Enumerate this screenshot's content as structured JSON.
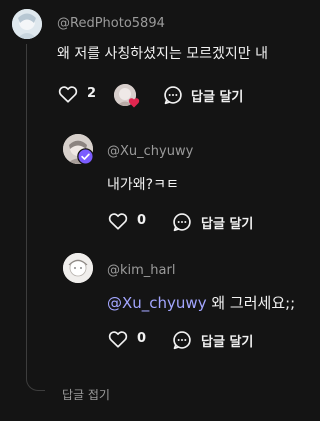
{
  "colors": {
    "background": "#141414",
    "text": "#f2f2f2",
    "muted": "#9b9b9b",
    "mention": "#a3a6ff",
    "badge": "#7b5cff",
    "heart_badge": "#e0264f",
    "thread_line": "#3d3d3d"
  },
  "parent": {
    "username": "@RedPhoto5894",
    "text": "왜 저를 사칭하셨지는 모르겠지만 내",
    "like_count": "2",
    "reply_label": "답글 달기",
    "icons": [
      "heart-outline-icon",
      "comment-bubble-icon"
    ]
  },
  "replies": [
    {
      "username": "@Xu_chyuwy",
      "text": "내가왜?ㅋㅌ",
      "like_count": "0",
      "reply_label": "답글 달기",
      "verified": true
    },
    {
      "username": "@kim_harl",
      "mention": "@Xu_chyuwy",
      "text": " 왜 그러세요;;",
      "like_count": "0",
      "reply_label": "답글 달기",
      "verified": false
    }
  ],
  "collapse_label": "답글 접기"
}
